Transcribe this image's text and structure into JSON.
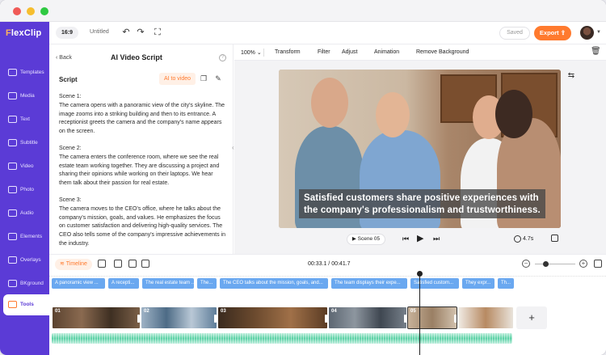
{
  "app": {
    "logo_prefix": "F",
    "logo_rest": "lexClip",
    "ratio": "16:9",
    "project_title": "Untitled",
    "saved_label": "Saved",
    "export_label": "Export"
  },
  "sidebar": {
    "items": [
      {
        "label": "Templates"
      },
      {
        "label": "Media"
      },
      {
        "label": "Text"
      },
      {
        "label": "Subtitle"
      },
      {
        "label": "Video"
      },
      {
        "label": "Photo"
      },
      {
        "label": "Audio"
      },
      {
        "label": "Elements"
      },
      {
        "label": "Overlays"
      },
      {
        "label": "BKground"
      },
      {
        "label": "Tools",
        "active": true
      }
    ]
  },
  "script_panel": {
    "back_label": "Back",
    "title": "AI Video Script",
    "script_label": "Script",
    "ai_button": "AI to video",
    "scenes": [
      {
        "heading": "Scene 1:",
        "text": "The camera opens with a panoramic view of the city's skyline. The image zooms into a striking building and then to its entrance. A receptionist greets the camera and the company's name appears on the screen."
      },
      {
        "heading": "Scene 2:",
        "text": "The camera enters the conference room, where we see the real estate team working together. They are discussing a project and sharing their opinions while working on their laptops. We hear them talk about their passion for real estate."
      },
      {
        "heading": "Scene 3:",
        "text": "The camera moves to the CEO's office, where he talks about the company's mission, goals, and values. He emphasizes the focus on customer satisfaction and delivering high-quality services. The CEO also tells some of the company's impressive achievements in the industry."
      }
    ]
  },
  "editor_toolbar": {
    "zoom": "100%",
    "items": [
      "Transform",
      "Filter",
      "Adjust",
      "Animation",
      "Remove Background"
    ]
  },
  "preview": {
    "caption_line1": "Satisfied customers share positive experiences with",
    "caption_line2": "the company's professionalism and trustworthiness.",
    "scene_label": "Scene 05",
    "duration": "4.7s"
  },
  "timeline": {
    "button_label": "Timeline",
    "timecode": "00:33.1 / 00:41.7",
    "subtitles": [
      "A panoramic view ...",
      "A recepti...",
      "The real estate team ...",
      "The...",
      "The CEO talks about the mission, goals, and...",
      "The team displays their expe...",
      "Satisfied custom...",
      "They expr...",
      "Th..."
    ],
    "clips": [
      "01",
      "02",
      "03",
      "04",
      "05",
      ""
    ],
    "zoom_level": 0.2
  },
  "colors": {
    "rail": "#5b3bd6",
    "accent": "#ff7a2e",
    "subtitle_clip": "#6aa8f0",
    "audio": "#58d1a4"
  }
}
